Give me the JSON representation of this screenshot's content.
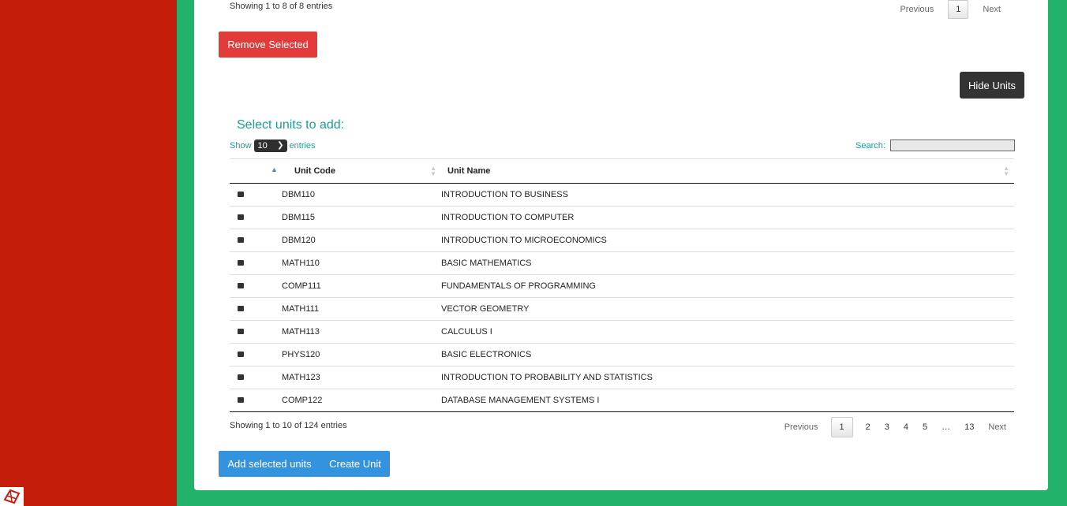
{
  "top_table": {
    "info": "Showing 1 to 8 of 8 entries",
    "pager": {
      "previous": "Previous",
      "current": "1",
      "next": "Next"
    }
  },
  "actions": {
    "remove_selected": "Remove Selected",
    "hide_units": "Hide Units",
    "add_selected": "Add selected units",
    "create_unit": "Create Unit"
  },
  "units_section": {
    "title": "Select units to add:",
    "length": {
      "show": "Show",
      "value": "10",
      "entries": "entries"
    },
    "search": {
      "label": "Search:",
      "value": ""
    },
    "columns": [
      "",
      "Unit Code",
      "Unit Name"
    ],
    "rows": [
      {
        "code": "DBM110",
        "name": "INTRODUCTION TO BUSINESS"
      },
      {
        "code": "DBM115",
        "name": "INTRODUCTION TO COMPUTER"
      },
      {
        "code": "DBM120",
        "name": "INTRODUCTION TO MICROECONOMICS"
      },
      {
        "code": "MATH110",
        "name": "BASIC MATHEMATICS"
      },
      {
        "code": "COMP111",
        "name": "FUNDAMENTALS OF PROGRAMMING"
      },
      {
        "code": "MATH111",
        "name": "VECTOR GEOMETRY"
      },
      {
        "code": "MATH113",
        "name": "CALCULUS I"
      },
      {
        "code": "PHYS120",
        "name": "BASIC ELECTRONICS"
      },
      {
        "code": "MATH123",
        "name": "INTRODUCTION TO PROBABILITY AND STATISTICS"
      },
      {
        "code": "COMP122",
        "name": "DATABASE MANAGEMENT SYSTEMS I"
      }
    ],
    "info": "Showing 1 to 10 of 124 entries",
    "pager": {
      "previous": "Previous",
      "pages": [
        "1",
        "2",
        "3",
        "4",
        "5"
      ],
      "ellipsis": "…",
      "last": "13",
      "next": "Next"
    }
  },
  "colors": {
    "sidebar": "#c61d0b",
    "background": "#22b26a",
    "remove_button": "#e33a3a",
    "primary_button": "#3393df",
    "dark_button": "#333333",
    "accent_text": "#1aa093"
  }
}
